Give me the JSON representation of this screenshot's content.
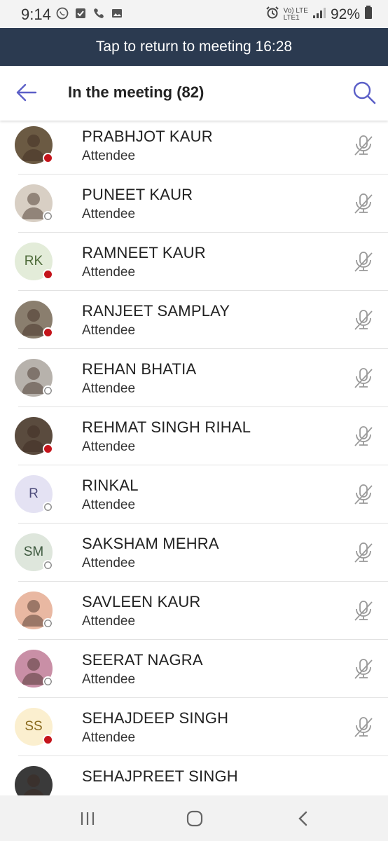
{
  "status_bar": {
    "time": "9:14",
    "network": "Vo) LTE",
    "network_sub": "LTE1",
    "battery": "92%"
  },
  "banner": {
    "text": "Tap to return to meeting 16:28"
  },
  "header": {
    "title": "In the meeting (82)"
  },
  "colors": {
    "banner_bg": "#2b3a50",
    "busy_dot": "#c4141b",
    "offline_dot": "#ffffff",
    "accent": "#6264a7"
  },
  "participants": [
    {
      "name": "",
      "role": "Attendee",
      "initials": "",
      "avatar_type": "photo",
      "avatar_color": "#cfe3e3",
      "status": "busy"
    },
    {
      "name": "PRABHJOT KAUR",
      "role": "Attendee",
      "initials": "",
      "avatar_type": "photo",
      "avatar_color": "#6b5a43",
      "status": "busy"
    },
    {
      "name": "PUNEET KAUR",
      "role": "Attendee",
      "initials": "",
      "avatar_type": "photo",
      "avatar_color": "#d8cfc4",
      "status": "offline"
    },
    {
      "name": "RAMNEET KAUR",
      "role": "Attendee",
      "initials": "RK",
      "avatar_type": "initials",
      "avatar_color": "#e3ecd9",
      "text_color": "#4e6b3a",
      "status": "busy"
    },
    {
      "name": "RANJEET SAMPLAY",
      "role": "Attendee",
      "initials": "",
      "avatar_type": "photo",
      "avatar_color": "#8a7e6e",
      "status": "busy"
    },
    {
      "name": "REHAN BHATIA",
      "role": "Attendee",
      "initials": "",
      "avatar_type": "photo",
      "avatar_color": "#b7b2ac",
      "status": "offline"
    },
    {
      "name": "REHMAT SINGH RIHAL",
      "role": "Attendee",
      "initials": "",
      "avatar_type": "photo",
      "avatar_color": "#5a4b3e",
      "status": "busy"
    },
    {
      "name": "RINKAL",
      "role": "Attendee",
      "initials": "R",
      "avatar_type": "initials",
      "avatar_color": "#e4e2f3",
      "text_color": "#4c4b7a",
      "status": "offline"
    },
    {
      "name": "SAKSHAM MEHRA",
      "role": "Attendee",
      "initials": "SM",
      "avatar_type": "initials",
      "avatar_color": "#dee6dc",
      "text_color": "#3f5a40",
      "status": "offline"
    },
    {
      "name": "SAVLEEN KAUR",
      "role": "Attendee",
      "initials": "",
      "avatar_type": "photo",
      "avatar_color": "#e9b8a2",
      "status": "offline"
    },
    {
      "name": "SEERAT NAGRA",
      "role": "Attendee",
      "initials": "",
      "avatar_type": "photo",
      "avatar_color": "#c98fa6",
      "status": "offline"
    },
    {
      "name": "SEHAJDEEP SINGH",
      "role": "Attendee",
      "initials": "SS",
      "avatar_type": "initials",
      "avatar_color": "#fbefcf",
      "text_color": "#8a6a1d",
      "status": "busy"
    },
    {
      "name": "SEHAJPREET SINGH",
      "role": "",
      "initials": "",
      "avatar_type": "photo",
      "avatar_color": "#3a3a3a",
      "status": ""
    }
  ]
}
